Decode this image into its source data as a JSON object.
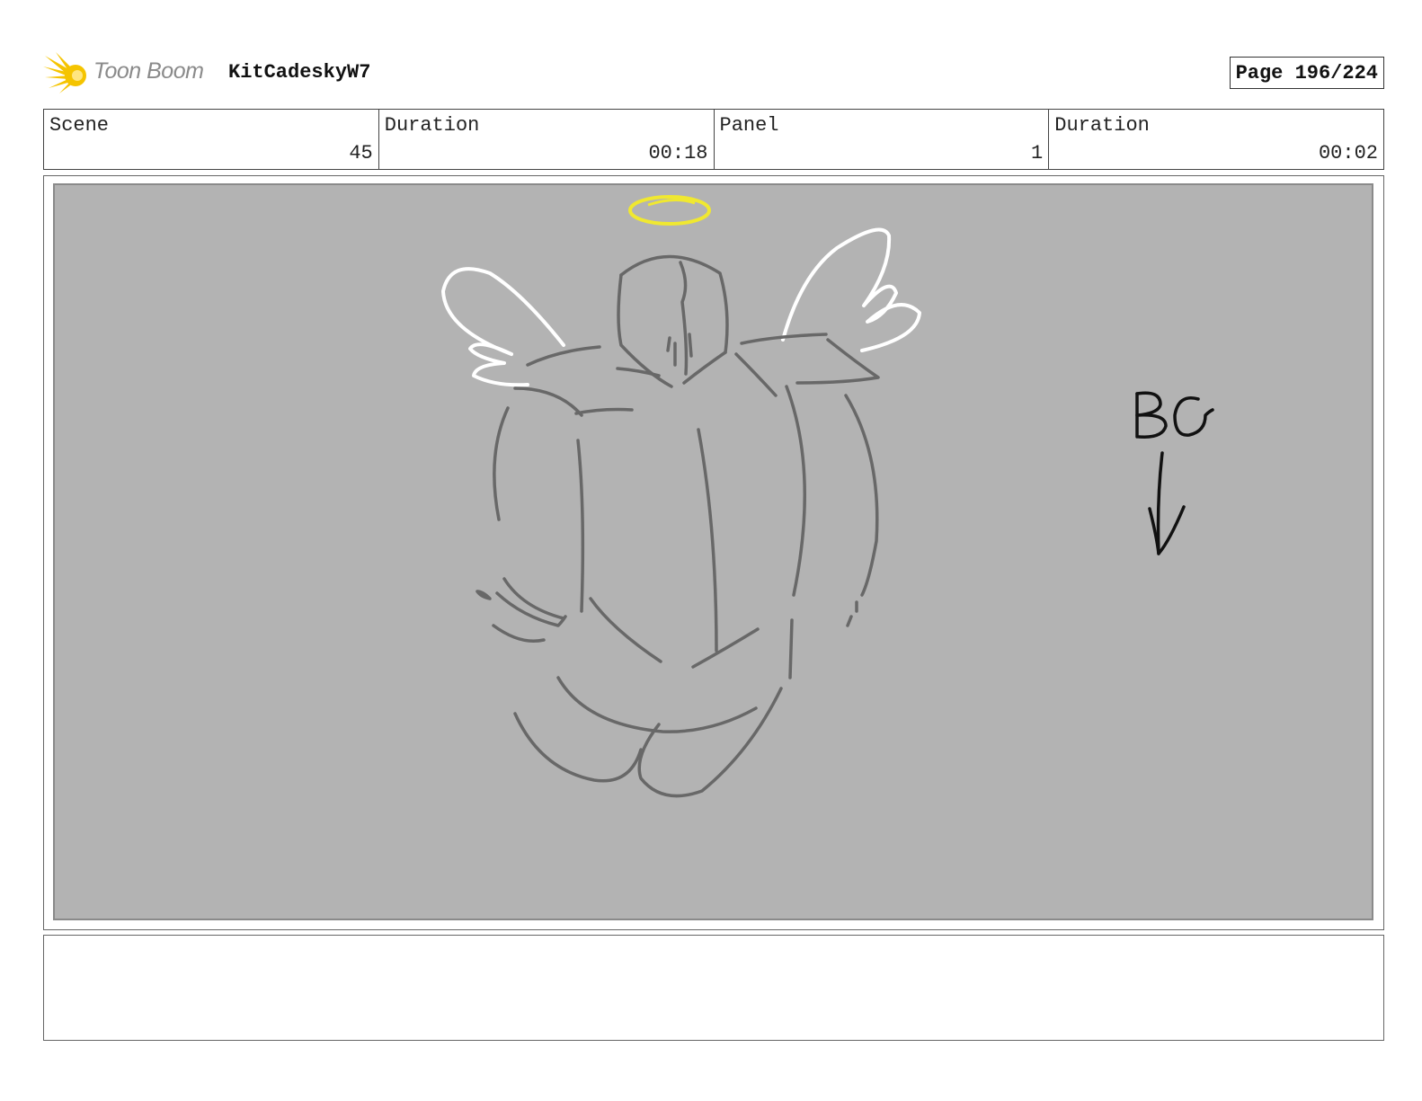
{
  "header": {
    "logo": {
      "text": "Toon Boom",
      "icon": "toon-boom-burst-logo",
      "color": "#f5c400"
    },
    "project_title": "KitCadeskyW7",
    "page_label": "Page 196/224"
  },
  "info": {
    "scene_label": "Scene",
    "scene_value": "45",
    "scene_duration_label": "Duration",
    "scene_duration_value": "00:18",
    "panel_label": "Panel",
    "panel_value": "1",
    "panel_duration_label": "Duration",
    "panel_duration_value": "00:02"
  },
  "panel": {
    "background_color": "#b3b3b3",
    "annotation_text": "BG",
    "annotation_icon": "down-arrow-icon",
    "halo_color": "#f0e830",
    "wing_color": "#ffffff",
    "body_line_color": "#686868"
  },
  "notes": {
    "text": ""
  }
}
